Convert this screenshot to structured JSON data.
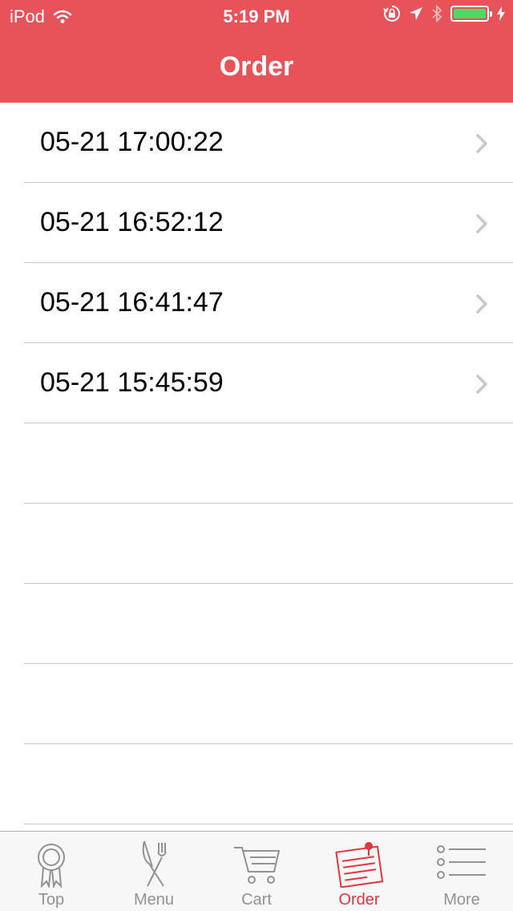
{
  "status_bar": {
    "carrier": "iPod",
    "time": "5:19 PM",
    "battery_color": "#4cd964",
    "icons": [
      "wifi-icon",
      "rotation-lock-icon",
      "location-icon",
      "bluetooth-icon",
      "battery-icon",
      "charging-icon"
    ]
  },
  "header": {
    "title": "Order",
    "background_color": "#e8535a"
  },
  "orders": [
    {
      "label": "05-21 17:00:22"
    },
    {
      "label": "05-21 16:52:12"
    },
    {
      "label": "05-21 16:41:47"
    },
    {
      "label": "05-21 15:45:59"
    }
  ],
  "tab_bar": {
    "active_color": "#e0363f",
    "inactive_color": "#929292",
    "selected": "Order",
    "items": [
      {
        "label": "Top",
        "icon": "ribbon-icon"
      },
      {
        "label": "Menu",
        "icon": "fork-knife-icon"
      },
      {
        "label": "Cart",
        "icon": "cart-icon"
      },
      {
        "label": "Order",
        "icon": "order-note-icon"
      },
      {
        "label": "More",
        "icon": "list-icon"
      }
    ]
  }
}
